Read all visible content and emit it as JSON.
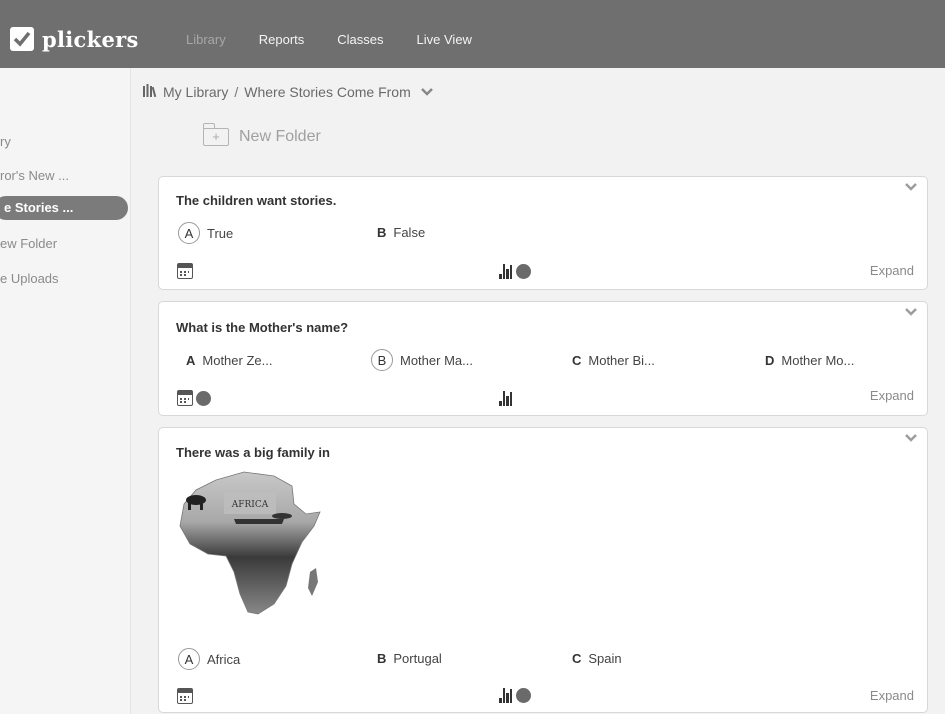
{
  "app": {
    "logo_text": "plickers",
    "nav": [
      "Library",
      "Reports",
      "Classes",
      "Live View"
    ]
  },
  "sidebar": {
    "items": [
      "ry",
      "ror's New ...",
      "e Stories ...",
      "ew Folder",
      "e Uploads"
    ]
  },
  "breadcrumb": {
    "root": "My Library",
    "separator": "/",
    "current": "Where Stories Come From"
  },
  "toolbar": {
    "new_folder": "New Folder",
    "new_folder_plus": "+"
  },
  "cards": [
    {
      "question": "The children want stories.",
      "answers": [
        {
          "letter": "A",
          "text": "True",
          "correct": true
        },
        {
          "letter": "B",
          "text": "False",
          "correct": false
        }
      ],
      "expand": "Expand"
    },
    {
      "question": "What is the Mother's name?",
      "answers": [
        {
          "letter": "A",
          "text": "Mother Ze...",
          "correct": false
        },
        {
          "letter": "B",
          "text": "Mother Ma...",
          "correct": true
        },
        {
          "letter": "C",
          "text": "Mother Bi...",
          "correct": false
        },
        {
          "letter": "D",
          "text": "Mother Mo...",
          "correct": false
        }
      ],
      "expand": "Expand"
    },
    {
      "question": "There was a big family in",
      "image_label": "AFRICA",
      "answers": [
        {
          "letter": "A",
          "text": "Africa",
          "correct": true
        },
        {
          "letter": "B",
          "text": "Portugal",
          "correct": false
        },
        {
          "letter": "C",
          "text": "Spain",
          "correct": false
        }
      ],
      "expand": "Expand"
    }
  ],
  "icons": [
    "logo-checkbox-icon",
    "library-icon",
    "chevron-down-icon",
    "folder-plus-icon",
    "calendar-icon",
    "bar-chart-icon",
    "dot-icon"
  ]
}
